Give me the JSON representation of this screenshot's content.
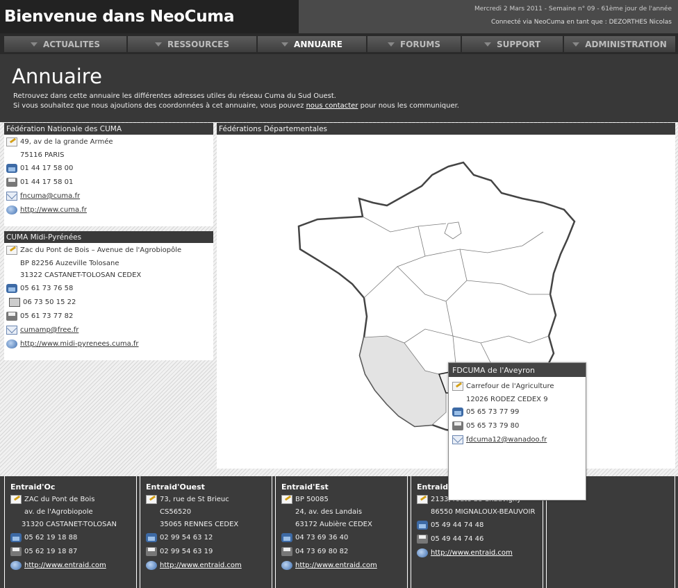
{
  "header": {
    "site_title": "Bienvenue dans NeoCuma",
    "date_line": "Mercredi 2 Mars 2011 - Semaine n° 09 - 61ème jour de l'année",
    "connected_line": "Connecté via NeoCuma en tant que : DEZORTHES Nicolas"
  },
  "nav": {
    "items": [
      {
        "label": "ACTUALITES"
      },
      {
        "label": "RESSOURCES"
      },
      {
        "label": "ANNUAIRE",
        "active": true
      },
      {
        "label": "FORUMS"
      },
      {
        "label": "SUPPORT"
      },
      {
        "label": "ADMINISTRATION"
      }
    ]
  },
  "page": {
    "title": "Annuaire",
    "intro_1": "Retrouvez dans cette annuaire les différentes adresses utiles du réseau Cuma du Sud Ouest.",
    "intro_2_before": "Si vous souhaitez que nous ajoutions des coordonnées à cet annuaire, vous pouvez ",
    "intro_2_link": "nous contacter",
    "intro_2_after": " pour nous les communiquer."
  },
  "fncuma": {
    "title": "Fédération Nationale des CUMA",
    "address_1": "49, av de la grande Armée",
    "address_2": "75116 PARIS",
    "phone": "01 44 17 58 00",
    "fax": "01 44 17 58 01",
    "email": "fncuma@cuma.fr",
    "web": "http://www.cuma.fr"
  },
  "midipyrenees": {
    "title": "CUMA Midi-Pyrénées",
    "address_1": "Zac du Pont de Bois – Avenue de l'Agrobiopôle",
    "address_2": "BP 82256 Auzeville Tolosane",
    "address_3": "31322 CASTANET-TOLOSAN CEDEX",
    "phone": "05 61 73 76 58",
    "mobile": "06 73 50 15 22",
    "fax": "05 61 73 77 82",
    "email": "cumamp@free.fr",
    "web": "http://www.midi-pyrenees.cuma.fr"
  },
  "federations": {
    "title": "Fédérations Départementales"
  },
  "popup": {
    "title": "FDCUMA de l'Aveyron",
    "close": "✕",
    "address_1": "Carrefour de l'Agriculture",
    "address_2": "12026 RODEZ CEDEX 9",
    "phone": "05 65 73 77 99",
    "fax": "05 65 73 79 80",
    "email": "fdcuma12@wanadoo.fr"
  },
  "entraid": [
    {
      "name": "Entraid'Oc",
      "address_1": "ZAC du Pont de Bois",
      "address_2": "av. de l'Agrobiopole",
      "address_3": "31320 CASTANET-TOLOSAN",
      "phone": "05 62 19 18 88",
      "fax": "05 62 19 18 87",
      "web": "http://www.entraid.com"
    },
    {
      "name": "Entraid'Ouest",
      "address_1": "73, rue de St Brieuc",
      "address_2": "CS56520",
      "address_3": "35065 RENNES CEDEX",
      "phone": "02 99 54 63 12",
      "fax": "02 99 54 63 19",
      "web": "http://www.entraid.com"
    },
    {
      "name": "Entraid'Est",
      "address_1": "BP 50085",
      "address_2": "24, av. des Landais",
      "address_3": "63172 Aubière CEDEX",
      "phone": "04 73 69 36 40",
      "fax": "04 73 69 80 82",
      "web": "http://www.entraid.com"
    },
    {
      "name": "Entraid'",
      "address_1": "2133, route de Chauvigny",
      "address_2": "86550 MIGNALOUX-BEAUVOIR",
      "phone": "05 49 44 74 48",
      "fax": "05 49 44 74 46",
      "web": "http://www.entraid.com"
    }
  ]
}
